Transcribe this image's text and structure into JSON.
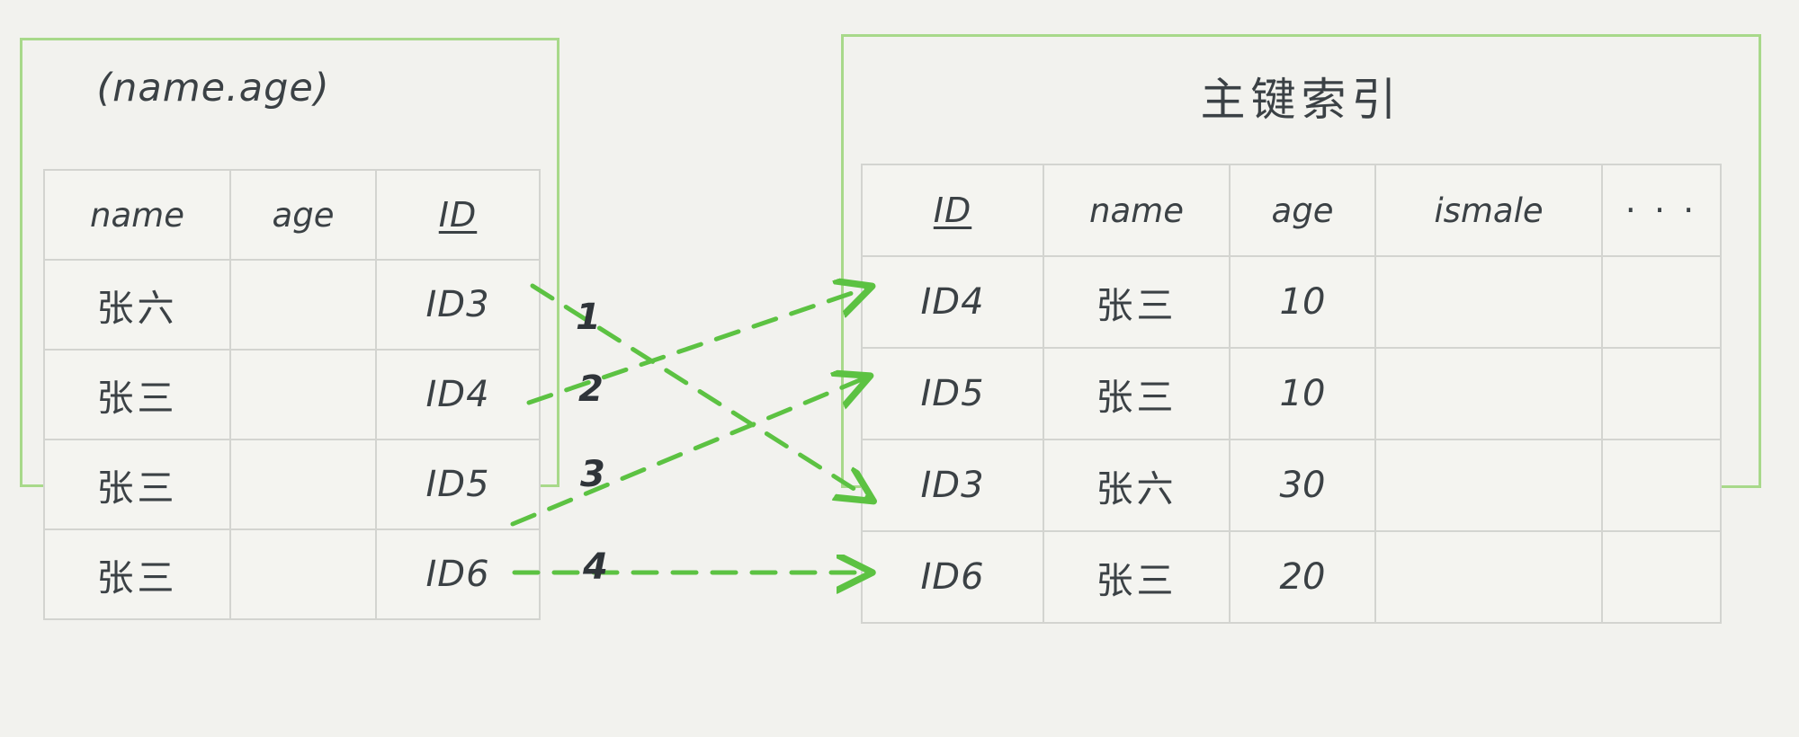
{
  "theme": {
    "background": "#f2f2ee",
    "panel_border": "#a8d98a",
    "arrow_color": "#5cc242",
    "table_border": "#d3d4d0",
    "ink": "#3b4145"
  },
  "left_panel": {
    "title": "(name.age)",
    "table": {
      "headers": [
        "name",
        "age",
        "ID"
      ],
      "rows": [
        {
          "name": "张六",
          "age": "",
          "id": "ID3"
        },
        {
          "name": "张三",
          "age": "",
          "id": "ID4"
        },
        {
          "name": "张三",
          "age": "",
          "id": "ID5"
        },
        {
          "name": "张三",
          "age": "",
          "id": "ID6"
        }
      ]
    }
  },
  "right_panel": {
    "title": "主键索引",
    "table": {
      "headers": [
        "ID",
        "name",
        "age",
        "ismale",
        "· · ·"
      ],
      "rows": [
        {
          "id": "ID4",
          "name": "张三",
          "age": "10",
          "ismale": "",
          "more": ""
        },
        {
          "id": "ID5",
          "name": "张三",
          "age": "10",
          "ismale": "",
          "more": ""
        },
        {
          "id": "ID3",
          "name": "张六",
          "age": "30",
          "ismale": "",
          "more": ""
        },
        {
          "id": "ID6",
          "name": "张三",
          "age": "20",
          "ismale": "",
          "more": ""
        }
      ]
    }
  },
  "arrows": [
    {
      "label": "1",
      "from": "ID3",
      "to": "ID3"
    },
    {
      "label": "2",
      "from": "ID4",
      "to": "ID4"
    },
    {
      "label": "3",
      "from": "ID5",
      "to": "ID5"
    },
    {
      "label": "4",
      "from": "ID6",
      "to": "ID6"
    }
  ]
}
